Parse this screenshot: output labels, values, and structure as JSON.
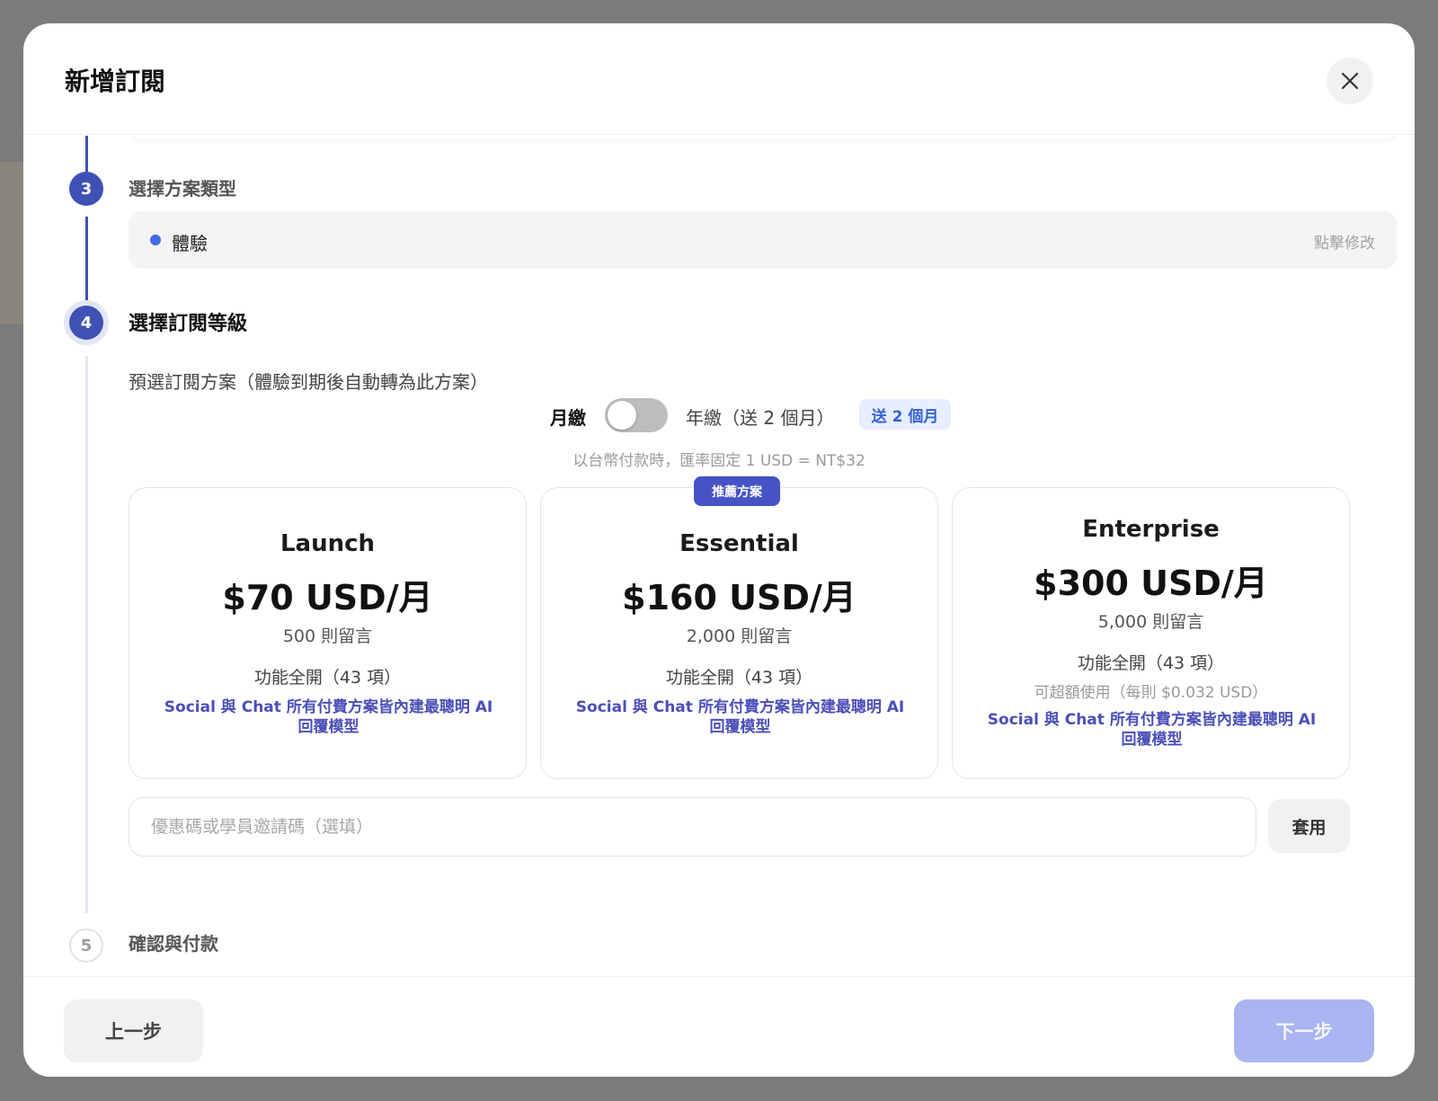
{
  "modal": {
    "title": "新增訂閱",
    "close_icon": "close-icon"
  },
  "steps": {
    "step3": {
      "number": "3",
      "title": "選擇方案類型",
      "selected_value": "體驗",
      "edit_label": "點擊修改"
    },
    "step4": {
      "number": "4",
      "title": "選擇訂閱等級",
      "subtitle": "預選訂閱方案（體驗到期後自動轉為此方案）"
    },
    "step5": {
      "number": "5",
      "title": "確認與付款"
    }
  },
  "billing": {
    "monthly_label": "月繳",
    "yearly_label": "年繳（送 2 個月）",
    "bonus_badge": "送 2 個月",
    "toggle_yearly_selected": false,
    "fx_note": "以台幣付款時，匯率固定 1 USD = NT$32"
  },
  "plans": [
    {
      "name": "Launch",
      "price": "$70 USD/月",
      "quota": "500 則留言",
      "features": "功能全開（43 項）",
      "ai_note": "Social 與 Chat 所有付費方案皆內建最聰明 AI 回覆模型"
    },
    {
      "name": "Essential",
      "price": "$160 USD/月",
      "quota": "2,000 則留言",
      "features": "功能全開（43 項）",
      "ai_note": "Social 與 Chat 所有付費方案皆內建最聰明 AI 回覆模型",
      "badge": "推薦方案"
    },
    {
      "name": "Enterprise",
      "price": "$300 USD/月",
      "quota": "5,000 則留言",
      "features": "功能全開（43 項）",
      "overage": "可超額使用（每則 $0.032 USD）",
      "ai_note": "Social 與 Chat 所有付費方案皆內建最聰明 AI 回覆模型"
    }
  ],
  "coupon": {
    "placeholder": "優惠碼或學員邀請碼（選填）",
    "value": "",
    "apply_label": "套用"
  },
  "footer": {
    "back_label": "上一步",
    "next_label": "下一步"
  },
  "colors": {
    "accent": "#3f51b5",
    "ai_text": "#4b4fb8",
    "next_disabled": "#a9b5f0"
  }
}
